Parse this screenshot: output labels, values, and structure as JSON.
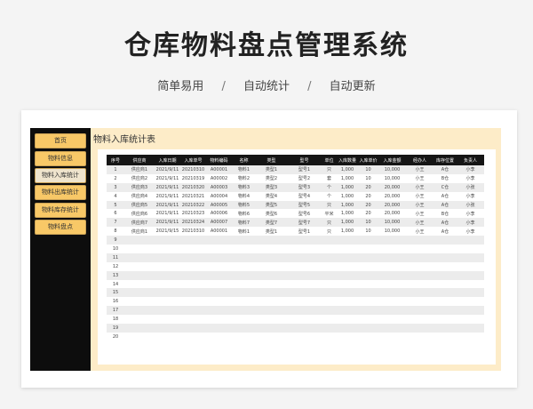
{
  "hero": {
    "title": "仓库物料盘点管理系统",
    "features": [
      "简单易用",
      "自动统计",
      "自动更新"
    ],
    "separator": "/"
  },
  "sidebar": {
    "items": [
      {
        "label": "首页"
      },
      {
        "label": "物料信息"
      },
      {
        "label": "物料入库统计",
        "active": true
      },
      {
        "label": "物料出库统计"
      },
      {
        "label": "物料库存统计"
      },
      {
        "label": "物料盘点"
      }
    ]
  },
  "panel": {
    "title": "物料入库统计表",
    "columns": [
      "序号",
      "供应商",
      "入库日期",
      "入库单号",
      "物料编码",
      "名称",
      "类型",
      "型号",
      "单位",
      "入库数量",
      "入库单价",
      "入库金额",
      "经办人",
      "库存位置",
      "负责人"
    ],
    "rows": [
      [
        "1",
        "供应商1",
        "2021/9/11",
        "20210310",
        "A00001",
        "物料1",
        "类型1",
        "型号1",
        "只",
        "1,000",
        "10",
        "10,000",
        "小王",
        "A仓",
        "小李"
      ],
      [
        "2",
        "供应商2",
        "2021/9/11",
        "20210319",
        "A00002",
        "物料2",
        "类型2",
        "型号2",
        "套",
        "1,000",
        "10",
        "10,000",
        "小王",
        "B仓",
        "小李"
      ],
      [
        "3",
        "供应商3",
        "2021/9/11",
        "20210320",
        "A00003",
        "物料3",
        "类型3",
        "型号3",
        "个",
        "1,000",
        "20",
        "20,000",
        "小王",
        "C仓",
        "小张"
      ],
      [
        "4",
        "供应商4",
        "2021/9/11",
        "20210321",
        "A00004",
        "物料4",
        "类型4",
        "型号4",
        "个",
        "1,000",
        "20",
        "20,000",
        "小王",
        "A仓",
        "小李"
      ],
      [
        "5",
        "供应商5",
        "2021/9/11",
        "20210322",
        "A00005",
        "物料5",
        "类型5",
        "型号5",
        "只",
        "1,000",
        "20",
        "20,000",
        "小王",
        "A仓",
        "小张"
      ],
      [
        "6",
        "供应商6",
        "2021/9/11",
        "20210323",
        "A00006",
        "物料6",
        "类型6",
        "型号6",
        "平米",
        "1,000",
        "20",
        "20,000",
        "小王",
        "B仓",
        "小李"
      ],
      [
        "7",
        "供应商7",
        "2021/9/11",
        "20210324",
        "A00007",
        "物料7",
        "类型7",
        "型号7",
        "只",
        "1,000",
        "10",
        "10,000",
        "小王",
        "A仓",
        "小李"
      ],
      [
        "8",
        "供应商1",
        "2021/9/15",
        "20210310",
        "A00001",
        "物料1",
        "类型1",
        "型号1",
        "只",
        "1,000",
        "10",
        "10,000",
        "小王",
        "A仓",
        "小李"
      ],
      [
        "9",
        "",
        "",
        "",
        "",
        "",
        "",
        "",
        "",
        "",
        "",
        "",
        "",
        "",
        ""
      ],
      [
        "10",
        "",
        "",
        "",
        "",
        "",
        "",
        "",
        "",
        "",
        "",
        "",
        "",
        "",
        ""
      ],
      [
        "11",
        "",
        "",
        "",
        "",
        "",
        "",
        "",
        "",
        "",
        "",
        "",
        "",
        "",
        ""
      ],
      [
        "12",
        "",
        "",
        "",
        "",
        "",
        "",
        "",
        "",
        "",
        "",
        "",
        "",
        "",
        ""
      ],
      [
        "13",
        "",
        "",
        "",
        "",
        "",
        "",
        "",
        "",
        "",
        "",
        "",
        "",
        "",
        ""
      ],
      [
        "14",
        "",
        "",
        "",
        "",
        "",
        "",
        "",
        "",
        "",
        "",
        "",
        "",
        "",
        ""
      ],
      [
        "15",
        "",
        "",
        "",
        "",
        "",
        "",
        "",
        "",
        "",
        "",
        "",
        "",
        "",
        ""
      ],
      [
        "16",
        "",
        "",
        "",
        "",
        "",
        "",
        "",
        "",
        "",
        "",
        "",
        "",
        "",
        ""
      ],
      [
        "17",
        "",
        "",
        "",
        "",
        "",
        "",
        "",
        "",
        "",
        "",
        "",
        "",
        "",
        ""
      ],
      [
        "18",
        "",
        "",
        "",
        "",
        "",
        "",
        "",
        "",
        "",
        "",
        "",
        "",
        "",
        ""
      ],
      [
        "19",
        "",
        "",
        "",
        "",
        "",
        "",
        "",
        "",
        "",
        "",
        "",
        "",
        "",
        ""
      ],
      [
        "20",
        "",
        "",
        "",
        "",
        "",
        "",
        "",
        "",
        "",
        "",
        "",
        "",
        "",
        ""
      ]
    ]
  },
  "colors": {
    "sidebar_bg": "#0d0d0d",
    "nav_button": "#f8c867",
    "nav_button_active": "#efe4cd",
    "panel_bg": "#fdecc8",
    "header_bg": "#151515"
  }
}
